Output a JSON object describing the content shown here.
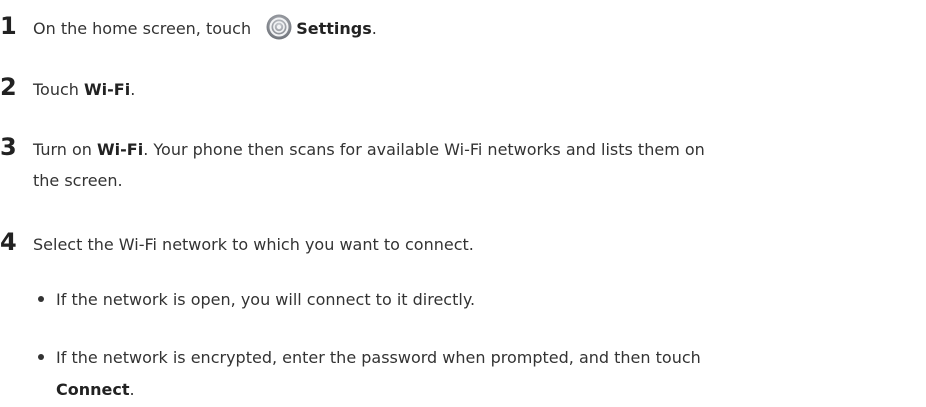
{
  "steps": [
    {
      "number": "1",
      "before": "On the home screen, touch ",
      "bold": "Settings",
      "after": "."
    },
    {
      "number": "2",
      "before": "Touch ",
      "bold": "Wi-Fi",
      "after": "."
    },
    {
      "number": "3",
      "before": "Turn on ",
      "bold": "Wi-Fi",
      "after": ". Your phone then scans for available Wi-Fi networks and lists them on",
      "continuation": "the screen."
    },
    {
      "number": "4",
      "text": "Select the Wi-Fi network to which you want to connect."
    }
  ],
  "bullets": [
    {
      "text": "If the network is open, you will connect to it directly."
    },
    {
      "text": "If the network is encrypted, enter the password when prompted, and then touch",
      "bold_line": "Connect",
      "after": "."
    }
  ],
  "icons": {
    "settings": "settings-gear-icon"
  }
}
